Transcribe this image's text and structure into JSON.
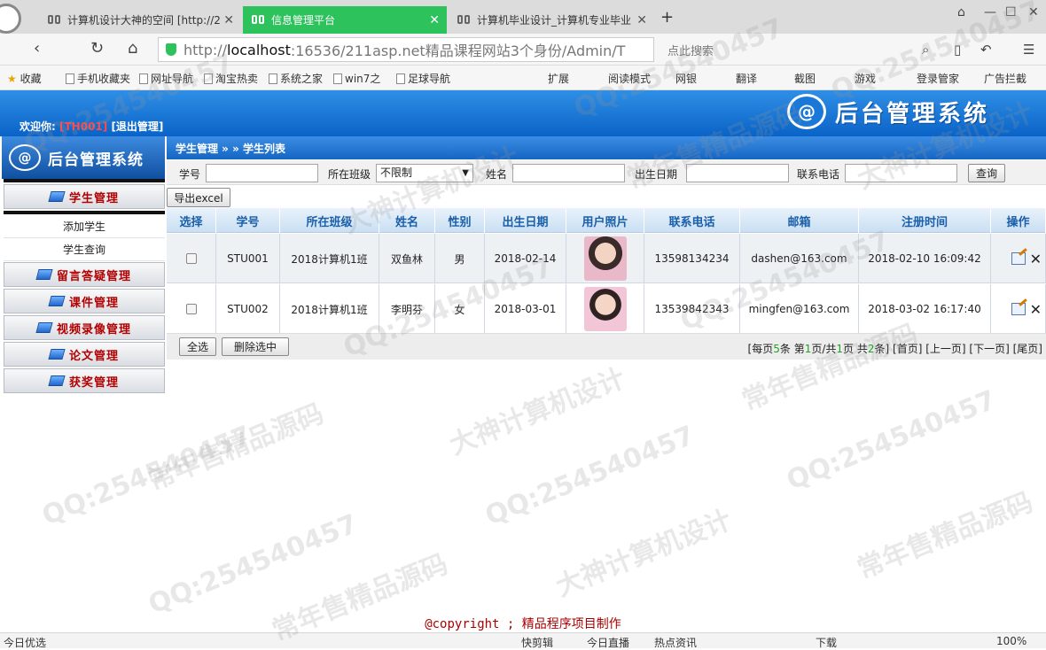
{
  "browser": {
    "tabs": [
      {
        "label": "计算机设计大神的空间 [http://2",
        "active": false
      },
      {
        "label": "信息管理平台",
        "active": true
      },
      {
        "label": "计算机毕业设计_计算机专业毕业",
        "active": false
      }
    ],
    "new_tab": "+",
    "window_controls": [
      "⌂",
      "—",
      "☐",
      "✕"
    ],
    "address": {
      "prefix": "http://",
      "host": "localhost",
      "rest": ":16536/211asp.net精品课程网站3个身份/Admin/T"
    },
    "search_placeholder": "点此搜索",
    "bookmarks": [
      "收藏",
      "手机收藏夹",
      "网址导航",
      "淘宝热卖",
      "系统之家",
      "win7之",
      "足球导航"
    ],
    "toolbar_right": [
      "扩展",
      "阅读模式",
      "网银",
      "翻译",
      "截图",
      "游戏",
      "登录管家",
      "广告拦截"
    ]
  },
  "header": {
    "welcome_prefix": "欢迎你:",
    "user_id": "[TH001]",
    "logout": "[退出管理]",
    "brand": "后台管理系统",
    "brand_mark": "@"
  },
  "sidebar": {
    "logo_text": "后台管理系统",
    "logo_mark": "@",
    "menu": [
      {
        "label": "学生管理",
        "children": [
          "添加学生",
          "学生查询"
        ]
      },
      {
        "label": "留言答疑管理"
      },
      {
        "label": "课件管理"
      },
      {
        "label": "视频录像管理"
      },
      {
        "label": "论文管理"
      },
      {
        "label": "获奖管理"
      }
    ]
  },
  "breadcrumb": "学生管理 » » 学生列表",
  "filter": {
    "student_no_label": "学号",
    "class_label": "所在班级",
    "class_selected": "不限制",
    "name_label": "姓名",
    "birth_label": "出生日期",
    "phone_label": "联系电话",
    "query_button": "查询"
  },
  "export_button": "导出excel",
  "table": {
    "columns": [
      "选择",
      "学号",
      "所在班级",
      "姓名",
      "性别",
      "出生日期",
      "用户照片",
      "联系电话",
      "邮箱",
      "注册时间",
      "操作"
    ],
    "rows": [
      {
        "id": "STU001",
        "class": "2018计算机1班",
        "name": "双鱼林",
        "gender": "男",
        "birth": "2018-02-14",
        "phone": "13598134234",
        "email": "dashen@163.com",
        "reg_time": "2018-02-10 16:09:42"
      },
      {
        "id": "STU002",
        "class": "2018计算机1班",
        "name": "李明芬",
        "gender": "女",
        "birth": "2018-03-01",
        "phone": "13539842343",
        "email": "mingfen@163.com",
        "reg_time": "2018-03-02 16:17:40"
      }
    ]
  },
  "actions": {
    "select_all": "全选",
    "delete_selected": "删除选中"
  },
  "pager": {
    "per_page_pre": "[每页",
    "per_page": "5",
    "per_page_mid": "条 第",
    "page": "1",
    "page_mid": "页/共",
    "total_pages": "1",
    "total_mid": "页 共",
    "total": "2",
    "total_post": "条]",
    "first": "[首页]",
    "prev": "[上一页]",
    "next": "[下一页]",
    "last": "[尾页]"
  },
  "copyright": "@copyright ; 精品程序项目制作",
  "statusbar": {
    "left": "今日优选",
    "items": [
      "快剪辑",
      "今日直播",
      "热点资讯",
      "下载"
    ],
    "zoom": "100%"
  },
  "watermarks": [
    "QQ:254540457",
    "常年售精品源码",
    "大神计算机设计"
  ],
  "colors": {
    "accent_blue": "#1566c4",
    "tab_green": "#2ec25c",
    "menu_red": "#b30000",
    "header_text": "#1a5fa8"
  }
}
